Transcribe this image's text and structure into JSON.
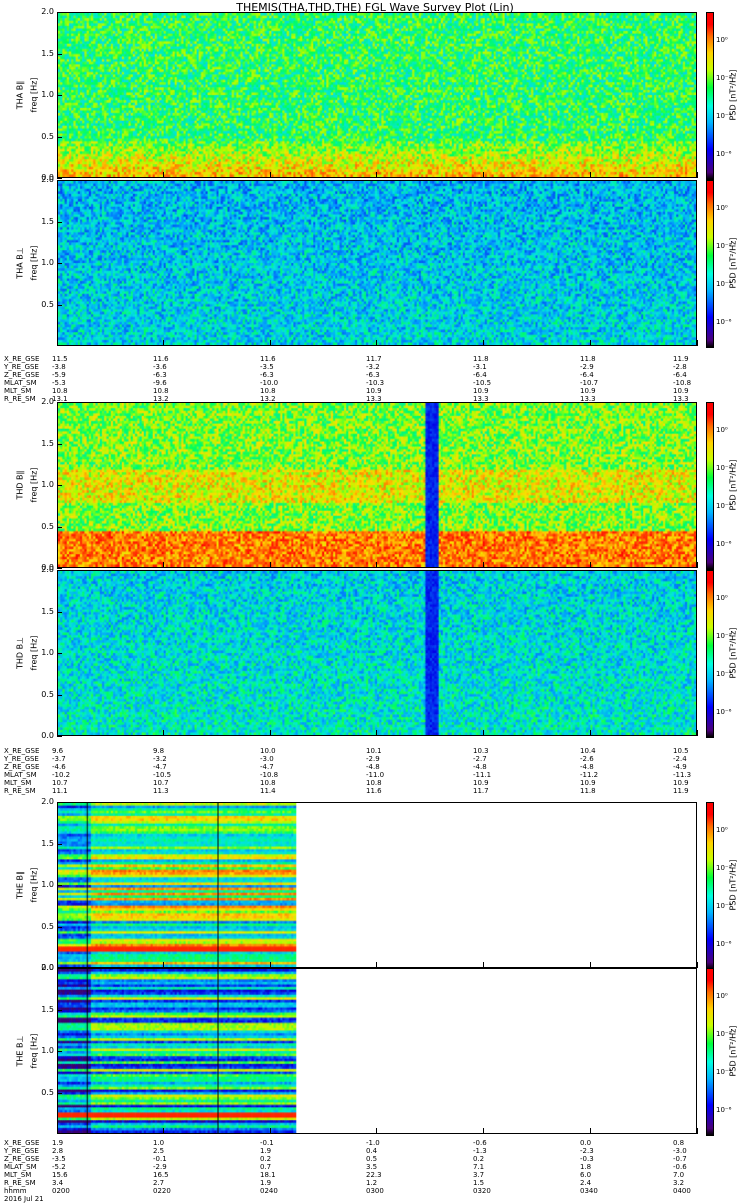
{
  "title": "THEMIS(THA,THD,THE) FGL Wave Survey Plot (Lin)",
  "colorbar": {
    "unit": "PSD [nT²/Hz]",
    "labels": [
      "10⁰",
      "10⁻²",
      "10⁻⁴",
      "10⁻⁶"
    ]
  },
  "panels": [
    {
      "id": "tha_bl",
      "probe": "THA",
      "label": "THA B∥",
      "ylabel": "freq [Hz]",
      "yticks": [
        "2.0",
        "1.5",
        "1.0",
        "0.5",
        "0.0"
      ],
      "base": 0.52,
      "scheme": "par",
      "gap": null
    },
    {
      "id": "tha_bt",
      "probe": "THA",
      "label": "THA B⊥",
      "ylabel": "freq [Hz]",
      "yticks": [
        "2.0",
        "1.5",
        "1.0",
        "0.5"
      ],
      "base": 0.38,
      "scheme": "perp",
      "gap": null
    },
    {
      "id": "thd_bl",
      "probe": "THD",
      "label": "THD B∥",
      "ylabel": "freq [Hz]",
      "yticks": [
        "2.0",
        "1.5",
        "1.0",
        "0.5",
        "0.0"
      ],
      "base": 0.6,
      "scheme": "parD",
      "gap": [
        0.575,
        0.595
      ]
    },
    {
      "id": "thd_bt",
      "probe": "THD",
      "label": "THD B⊥",
      "ylabel": "freq [Hz]",
      "yticks": [
        "2.0",
        "1.5",
        "1.0",
        "0.5",
        "0.0"
      ],
      "base": 0.42,
      "scheme": "perp",
      "gap": [
        0.575,
        0.595
      ]
    },
    {
      "id": "the_bl",
      "probe": "THE",
      "label": "THE B∥",
      "ylabel": "freq [Hz]",
      "yticks": [
        "2.0",
        "1.5",
        "1.0",
        "0.5",
        "0.0"
      ],
      "base": 0.45,
      "scheme": "bands",
      "gap": null,
      "end": 0.37
    },
    {
      "id": "the_bt",
      "probe": "THE",
      "label": "THE B⊥",
      "ylabel": "freq [Hz]",
      "yticks": [
        "2.0",
        "1.5",
        "1.0",
        "0.5"
      ],
      "base": 0.3,
      "scheme": "bands2",
      "gap": null,
      "end": 0.37
    }
  ],
  "ephem_blocks": [
    {
      "rows": [
        "X_RE_GSE",
        "Y_RE_GSE",
        "Z_RE_GSE",
        "MLAT_SM",
        "MLT_SM",
        "R_RE_SM"
      ],
      "cols": [
        [
          "11.5",
          "-3.8",
          "-5.9",
          "-5.3",
          "10.8",
          "13.1"
        ],
        [
          "11.6",
          "-3.6",
          "-6.3",
          "-9.6",
          "10.8",
          "13.2"
        ],
        [
          "11.6",
          "-3.5",
          "-6.3",
          "-10.0",
          "10.8",
          "13.2"
        ],
        [
          "11.7",
          "-3.2",
          "-6.3",
          "-10.3",
          "10.9",
          "13.3"
        ],
        [
          "11.8",
          "-3.1",
          "-6.4",
          "-10.5",
          "10.9",
          "13.3"
        ],
        [
          "11.8",
          "-2.9",
          "-6.4",
          "-10.7",
          "10.9",
          "13.3"
        ],
        [
          "11.9",
          "-2.8",
          "-6.4",
          "-10.8",
          "10.9",
          "13.3"
        ]
      ]
    },
    {
      "rows": [
        "X_RE_GSE",
        "Y_RE_GSE",
        "Z_RE_GSE",
        "MLAT_SM",
        "MLT_SM",
        "R_RE_SM"
      ],
      "cols": [
        [
          "9.6",
          "-3.7",
          "-4.6",
          "-10.2",
          "10.7",
          "11.1"
        ],
        [
          "9.8",
          "-3.2",
          "-4.7",
          "-10.5",
          "10.7",
          "11.3"
        ],
        [
          "10.0",
          "-3.0",
          "-4.7",
          "-10.8",
          "10.8",
          "11.4"
        ],
        [
          "10.1",
          "-2.9",
          "-4.8",
          "-11.0",
          "10.8",
          "11.6"
        ],
        [
          "10.3",
          "-2.7",
          "-4.8",
          "-11.1",
          "10.9",
          "11.7"
        ],
        [
          "10.4",
          "-2.6",
          "-4.8",
          "-11.2",
          "10.9",
          "11.8"
        ],
        [
          "10.5",
          "-2.4",
          "-4.9",
          "-11.3",
          "10.9",
          "11.9"
        ]
      ]
    },
    {
      "rows": [
        "X_RE_GSE",
        "Y_RE_GSE",
        "Z_RE_GSE",
        "MLAT_SM",
        "MLT_SM",
        "R_RE_SM",
        "hhmm",
        "2016 Jul 21"
      ],
      "cols": [
        [
          "1.9",
          "2.8",
          "-3.5",
          "-5.2",
          "15.6",
          "3.4",
          "0200"
        ],
        [
          "1.0",
          "2.5",
          "-0.1",
          "-2.9",
          "16.5",
          "2.7",
          "0220"
        ],
        [
          "-0.1",
          "1.9",
          "0.2",
          "0.7",
          "18.1",
          "1.9",
          "0240"
        ],
        [
          "-1.0",
          "0.4",
          "0.5",
          "3.5",
          "22.3",
          "1.2",
          "0300"
        ],
        [
          "-0.6",
          "-1.3",
          "0.2",
          "7.1",
          "3.7",
          "1.5",
          "0320"
        ],
        [
          "0.0",
          "-2.3",
          "-0.3",
          "1.8",
          "6.0",
          "2.4",
          "0340"
        ],
        [
          "0.8",
          "-3.0",
          "-0.7",
          "-0.6",
          "7.0",
          "3.2",
          "0400"
        ]
      ]
    }
  ],
  "chart_data": [
    {
      "type": "heatmap",
      "title": "THEMIS(THA,THD,THE) FGL Wave Survey Plot (Lin)",
      "series": [
        {
          "name": "THA B∥",
          "ylabel": "freq [Hz]",
          "ylim": [
            0,
            2.0
          ]
        },
        {
          "name": "THA B⊥",
          "ylabel": "freq [Hz]",
          "ylim": [
            0,
            2.0
          ]
        }
      ],
      "colorbar_label": "PSD [nT²/Hz]",
      "colorbar_ticks": [
        "10⁰",
        "10⁻²",
        "10⁻⁴",
        "10⁻⁶"
      ],
      "x_ticks_X_RE_GSE": [
        11.5,
        11.6,
        11.6,
        11.7,
        11.8,
        11.8,
        11.9
      ]
    },
    {
      "type": "heatmap",
      "series": [
        {
          "name": "THD B∥",
          "ylabel": "freq [Hz]",
          "ylim": [
            0,
            2.0
          ]
        },
        {
          "name": "THD B⊥",
          "ylabel": "freq [Hz]",
          "ylim": [
            0,
            2.0
          ]
        }
      ],
      "colorbar_label": "PSD [nT²/Hz]",
      "x_ticks_X_RE_GSE": [
        9.6,
        9.8,
        10.0,
        10.1,
        10.3,
        10.4,
        10.5
      ]
    },
    {
      "type": "heatmap",
      "series": [
        {
          "name": "THE B∥",
          "ylabel": "freq [Hz]",
          "ylim": [
            0,
            2.0
          ]
        },
        {
          "name": "THE B⊥",
          "ylabel": "freq [Hz]",
          "ylim": [
            0,
            2.0
          ]
        }
      ],
      "colorbar_label": "PSD [nT²/Hz]",
      "x_ticks_hhmm": [
        "0200",
        "0220",
        "0240",
        "0300",
        "0320",
        "0340",
        "0400"
      ],
      "date": "2016 Jul 21"
    }
  ]
}
